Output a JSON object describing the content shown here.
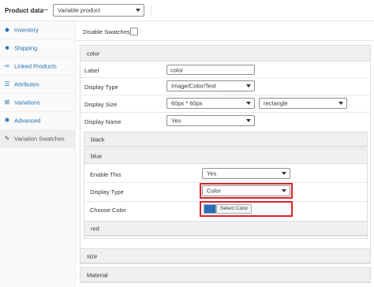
{
  "header": {
    "title": "Product data",
    "product_type": "Variable product"
  },
  "sidebar": {
    "items": [
      {
        "label": "Inventory",
        "icon": "tag-icon"
      },
      {
        "label": "Shipping",
        "icon": "truck-icon"
      },
      {
        "label": "Linked Products",
        "icon": "link-icon"
      },
      {
        "label": "Attributes",
        "icon": "list-icon"
      },
      {
        "label": "Variations",
        "icon": "grid-icon"
      },
      {
        "label": "Advanced",
        "icon": "gear-icon"
      },
      {
        "label": "Variation Swatches",
        "icon": "wrench-icon"
      }
    ],
    "active_index": 6
  },
  "main": {
    "disable_swatches_label": "Disable Swatches",
    "color_panel": {
      "title": "color",
      "fields": {
        "label_label": "Label",
        "label_value": "color",
        "display_type_label": "Display Type",
        "display_type_value": "Image/Color/Text",
        "display_size_label": "Display Size",
        "display_size_value": "60px * 60px",
        "display_size_mode": "rectangle",
        "display_name_label": "Display Name",
        "display_name_value": "Yes"
      },
      "terms": {
        "black": "black",
        "blue": {
          "title": "blue",
          "enable_this_label": "Enable This",
          "enable_this_value": "Yes",
          "display_type_label": "Display Type",
          "display_type_value": "Color",
          "choose_color_label": "Choose Color",
          "select_color_button": "Select Color",
          "swatch_color": "#2b6cb8"
        },
        "red": "red"
      }
    },
    "size_panel_title": "size",
    "material_panel_title": "Material"
  },
  "colors": {
    "link": "#2271b1",
    "highlight": "#d9242a"
  }
}
